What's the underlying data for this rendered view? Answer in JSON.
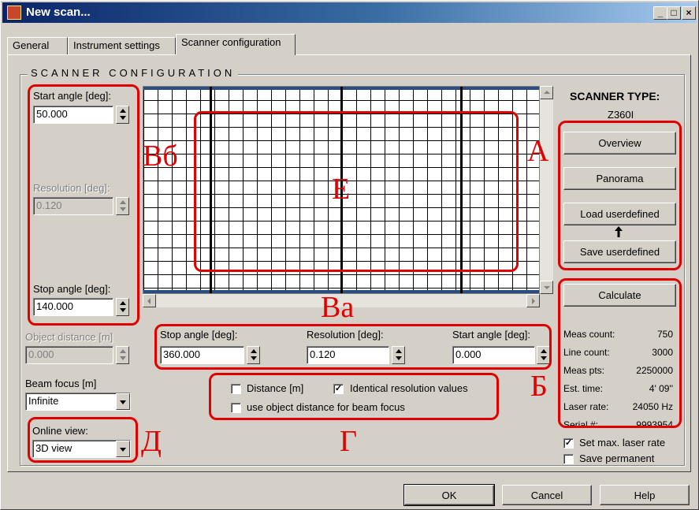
{
  "window": {
    "title": "New scan..."
  },
  "title_buttons": {
    "minimize": "_",
    "maximize": "□",
    "close": "×"
  },
  "tabs": [
    {
      "label": "General"
    },
    {
      "label": "Instrument settings"
    },
    {
      "label": "Scanner configuration",
      "active": true
    }
  ],
  "group": {
    "title": "SCANNER CONFIGURATION"
  },
  "vertical": {
    "start_angle": {
      "label": "Start angle [deg]:",
      "value": "50.000"
    },
    "resolution": {
      "label": "Resolution [deg]:",
      "value": "0.120",
      "disabled": true
    },
    "stop_angle": {
      "label": "Stop angle [deg]:",
      "value": "140.000"
    }
  },
  "object_distance": {
    "label": "Object distance [m]",
    "value": "0.000",
    "disabled": true
  },
  "beam_focus": {
    "label": "Beam focus [m]",
    "value": "Infinite"
  },
  "online_view": {
    "label": "Online view:",
    "value": "3D view"
  },
  "horizontal": {
    "stop_angle": {
      "label": "Stop angle [deg]:",
      "value": "360.000"
    },
    "resolution": {
      "label": "Resolution [deg]:",
      "value": "0.120"
    },
    "start_angle": {
      "label": "Start angle [deg]:",
      "value": "0.000"
    }
  },
  "options": {
    "distance": {
      "label": "Distance [m]",
      "checked": false
    },
    "identical_resolution": {
      "label": "Identical resolution values",
      "checked": true
    },
    "object_distance_focus": {
      "label": "use object distance for beam focus",
      "checked": false
    }
  },
  "scanner_type": {
    "label": "SCANNER TYPE:",
    "value": "Z360I"
  },
  "preset_buttons": {
    "overview": "Overview",
    "panorama": "Panorama",
    "load": "Load userdefined",
    "save": "Save userdefined"
  },
  "calculate_button": "Calculate",
  "stats": [
    {
      "label": "Meas count:",
      "value": "750"
    },
    {
      "label": "Line count:",
      "value": "3000"
    },
    {
      "label": "Meas pts:",
      "value": "2250000"
    },
    {
      "label": "Est. time:",
      "value": "4' 09''"
    },
    {
      "label": "Laser rate:",
      "value": "24050 Hz"
    },
    {
      "label": "Serial #:",
      "value": "9993954"
    }
  ],
  "set_max_laser_rate": {
    "label": "Set max. laser rate",
    "checked": true
  },
  "save_permanent": {
    "label": "Save permanent",
    "checked": false
  },
  "footer": {
    "ok": "OK",
    "cancel": "Cancel",
    "help": "Help"
  },
  "annotations": {
    "a": "А",
    "b": "Б",
    "v_a": "Ва",
    "v_b": "Вб",
    "g": "Г",
    "d": "Д",
    "e": "Е"
  },
  "colors": {
    "annotation": "#e00000",
    "title_bar": "#0a246a",
    "grid_bar": "#2a4e82"
  }
}
